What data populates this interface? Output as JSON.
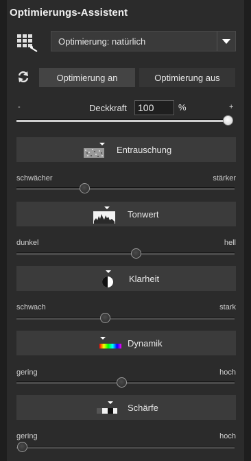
{
  "panel": {
    "title": "Optimierungs-Assistent",
    "preset": {
      "icon": "grid-wand-icon",
      "selected": "Optimierung: natürlich"
    },
    "toggle": {
      "icon": "sync-icon",
      "on_label": "Optimierung an",
      "off_label": "Optimierung aus",
      "active": "on"
    },
    "opacity": {
      "minus": "-",
      "plus": "+",
      "label": "Deckkraft",
      "value": "100",
      "unit": "%",
      "level": 1.0
    }
  },
  "sections": [
    {
      "label": "Entrauschung",
      "icon": "noise-icon",
      "min_label": "schwächer",
      "max_label": "stärker",
      "level": 0.3
    },
    {
      "label": "Tonwert",
      "icon": "histogram-icon",
      "min_label": "dunkel",
      "max_label": "hell",
      "level": 0.55
    },
    {
      "label": "Klarheit",
      "icon": "contrast-circle-icon",
      "min_label": "schwach",
      "max_label": "stark",
      "level": 0.4
    },
    {
      "label": "Dynamik",
      "icon": "spectrum-icon",
      "min_label": "gering",
      "max_label": "hoch",
      "level": 0.48
    },
    {
      "label": "Schärfe",
      "icon": "sharpness-icon",
      "min_label": "gering",
      "max_label": "hoch",
      "level": 0.0
    }
  ]
}
